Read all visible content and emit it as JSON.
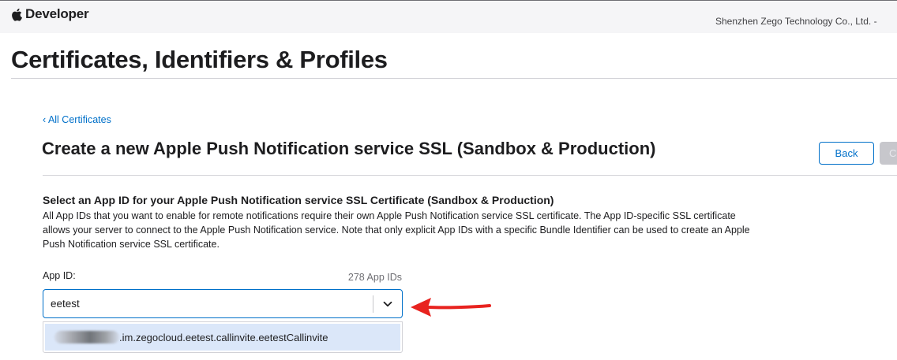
{
  "header": {
    "brand": "Developer",
    "account": "Shenzhen Zego Technology Co., Ltd. -"
  },
  "page": {
    "title": "Certificates, Identifiers & Profiles"
  },
  "nav": {
    "back_link": "‹ All Certificates"
  },
  "section": {
    "title": "Create a new Apple Push Notification service SSL (Sandbox & Production)",
    "back_button": "Back",
    "continue_button": "Continue"
  },
  "form": {
    "heading": "Select an App ID for your Apple Push Notification service SSL Certificate (Sandbox & Production)",
    "description": "All App IDs that you want to enable for remote notifications require their own Apple Push Notification service SSL certificate. The App ID-specific SSL certificate allows your server to connect to the Apple Push Notification service. Note that only explicit App IDs with a specific Bundle Identifier can be used to create an Apple Push Notification service SSL certificate.",
    "app_id_label": "App ID:",
    "app_id_count": "278 App IDs",
    "search_value": "eetest",
    "options": [
      {
        "label": ".im.zegocloud.eetest.callinvite.eetestCallinvite",
        "highlighted": true
      }
    ]
  },
  "colors": {
    "accent": "#0070c9",
    "highlight": "#dbe7f9",
    "annotation_arrow": "#e8231f"
  }
}
